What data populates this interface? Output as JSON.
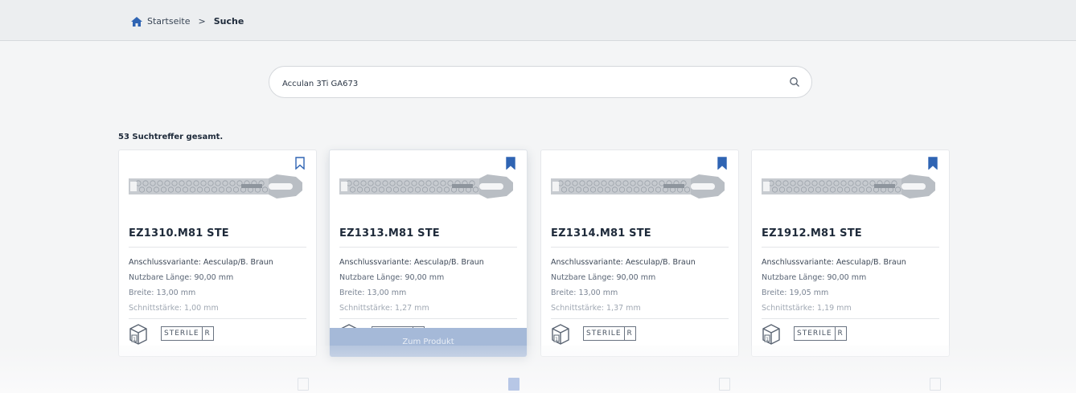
{
  "breadcrumb": {
    "home": "Startseite",
    "separator": ">",
    "current": "Suche"
  },
  "search": {
    "value": "Acculan 3Ti GA673"
  },
  "results": {
    "count_text": "53 Suchtreffer gesamt."
  },
  "cta_label": "Zum Produkt",
  "colors": {
    "accent": "#2f64b3",
    "cta": "#a5b9d8"
  },
  "cards": [
    {
      "code": "EZ1310.M81 STE",
      "bookmarked": false,
      "attributes": [
        "Anschlussvariante: Aesculap/B. Braun",
        "Nutzbare Länge: 90,00 mm",
        "Breite: 13,00 mm",
        "Schnittstärke: 1,00 mm"
      ],
      "sterile": [
        "STERILE",
        "R"
      ]
    },
    {
      "code": "EZ1313.M81 STE",
      "bookmarked": true,
      "attributes": [
        "Anschlussvariante: Aesculap/B. Braun",
        "Nutzbare Länge: 90,00 mm",
        "Breite: 13,00 mm",
        "Schnittstärke: 1,27 mm"
      ],
      "sterile": [
        "STERILE",
        "R"
      ]
    },
    {
      "code": "EZ1314.M81 STE",
      "bookmarked": true,
      "attributes": [
        "Anschlussvariante: Aesculap/B. Braun",
        "Nutzbare Länge: 90,00 mm",
        "Breite: 13,00 mm",
        "Schnittstärke: 1,37 mm"
      ],
      "sterile": [
        "STERILE",
        "R"
      ]
    },
    {
      "code": "EZ1912.M81 STE",
      "bookmarked": true,
      "attributes": [
        "Anschlussvariante: Aesculap/B. Braun",
        "Nutzbare Länge: 90,00 mm",
        "Breite: 19,05 mm",
        "Schnittstärke: 1,19 mm"
      ],
      "sterile": [
        "STERILE",
        "R"
      ]
    }
  ],
  "icons": {
    "home": "home-icon",
    "search": "search-icon",
    "bookmark": "bookmark-icon",
    "package": "package-box-icon"
  }
}
